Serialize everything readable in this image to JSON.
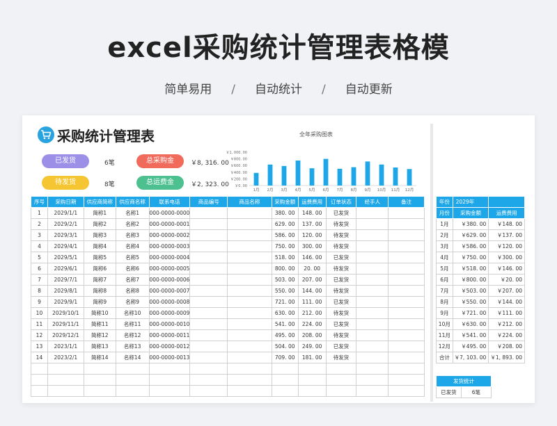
{
  "hero": {
    "title": "excel采购统计管理表格模",
    "tags": [
      "简单易用",
      "/",
      "自动统计",
      "/",
      "自动更新"
    ]
  },
  "sheet": {
    "title": "采购统计管理表",
    "summary": [
      {
        "label": "已发货",
        "value": "6笔",
        "color": "#9b8fe8"
      },
      {
        "label": "待发货",
        "value": "8笔",
        "color": "#f5c631"
      },
      {
        "label": "总采购金",
        "value": "￥8, 316. 00",
        "color": "#f06b5c"
      },
      {
        "label": "总运费金",
        "value": "￥2, 323. 00",
        "color": "#4cc08e"
      }
    ]
  },
  "chart_data": {
    "type": "bar",
    "title": "全年采购图表",
    "categories": [
      "1月",
      "2月",
      "3月",
      "4月",
      "5月",
      "6月",
      "7月",
      "8月",
      "9月",
      "10月",
      "11月",
      "12月"
    ],
    "values": [
      380,
      629,
      586,
      750,
      518,
      800,
      503,
      550,
      721,
      630,
      541,
      495
    ],
    "ylim": [
      0,
      1000
    ],
    "yticks": [
      0,
      200,
      400,
      600,
      800,
      1000
    ],
    "ytick_labels": [
      "￥0. 00",
      "￥200. 00",
      "￥400. 00",
      "￥600. 00",
      "￥800. 00",
      "￥1, 000. 00"
    ],
    "color": "#1ea7e8",
    "grid": false
  },
  "main_table": {
    "headers": [
      "序号",
      "采购日期",
      "供应商简称",
      "供应商名称",
      "联系电话",
      "商品编号",
      "商品名称",
      "采购金额",
      "运费费用",
      "订单状态",
      "经手人",
      "备注"
    ],
    "rows": [
      [
        "1",
        "2029/1/1",
        "简称1",
        "名称1",
        "000-0000-0000",
        "",
        "",
        "380. 00",
        "148. 00",
        "已发货",
        "",
        ""
      ],
      [
        "2",
        "2029/2/1",
        "简称2",
        "名称2",
        "000-0000-0001",
        "",
        "",
        "629. 00",
        "137. 00",
        "待发货",
        "",
        ""
      ],
      [
        "3",
        "2029/3/1",
        "简称3",
        "名称3",
        "000-0000-0002",
        "",
        "",
        "586. 00",
        "120. 00",
        "待发货",
        "",
        ""
      ],
      [
        "4",
        "2029/4/1",
        "简称4",
        "名称4",
        "000-0000-0003",
        "",
        "",
        "750. 00",
        "300. 00",
        "待发货",
        "",
        ""
      ],
      [
        "5",
        "2029/5/1",
        "简称5",
        "名称5",
        "000-0000-0004",
        "",
        "",
        "518. 00",
        "146. 00",
        "已发货",
        "",
        ""
      ],
      [
        "6",
        "2029/6/1",
        "简称6",
        "名称6",
        "000-0000-0005",
        "",
        "",
        "800. 00",
        "20. 00",
        "待发货",
        "",
        ""
      ],
      [
        "7",
        "2029/7/1",
        "简称7",
        "名称7",
        "000-0000-0006",
        "",
        "",
        "503. 00",
        "207. 00",
        "已发货",
        "",
        ""
      ],
      [
        "8",
        "2029/8/1",
        "简称8",
        "名称8",
        "000-0000-0007",
        "",
        "",
        "550. 00",
        "144. 00",
        "待发货",
        "",
        ""
      ],
      [
        "9",
        "2029/9/1",
        "简称9",
        "名称9",
        "000-0000-0008",
        "",
        "",
        "721. 00",
        "111. 00",
        "已发货",
        "",
        ""
      ],
      [
        "10",
        "2029/10/1",
        "简称10",
        "名称10",
        "000-0000-0009",
        "",
        "",
        "630. 00",
        "212. 00",
        "待发货",
        "",
        ""
      ],
      [
        "11",
        "2029/11/1",
        "简称11",
        "名称11",
        "000-0000-0010",
        "",
        "",
        "541. 00",
        "224. 00",
        "已发货",
        "",
        ""
      ],
      [
        "12",
        "2029/12/1",
        "简称12",
        "名称12",
        "000-0000-0011",
        "",
        "",
        "495. 00",
        "208. 00",
        "待发货",
        "",
        ""
      ],
      [
        "13",
        "2023/1/1",
        "简称13",
        "名称13",
        "000-0000-0012",
        "",
        "",
        "504. 00",
        "249. 00",
        "已发货",
        "",
        ""
      ],
      [
        "14",
        "2023/2/1",
        "简称14",
        "名称14",
        "000-0000-0013",
        "",
        "",
        "709. 00",
        "181. 00",
        "待发货",
        "",
        ""
      ],
      [
        "",
        "",
        "",
        "",
        "",
        "",
        "",
        "",
        "",
        "",
        "",
        ""
      ],
      [
        "",
        "",
        "",
        "",
        "",
        "",
        "",
        "",
        "",
        "",
        "",
        ""
      ],
      [
        "",
        "",
        "",
        "",
        "",
        "",
        "",
        "",
        "",
        "",
        "",
        ""
      ]
    ]
  },
  "side_table": {
    "year_label": "年份",
    "year_value": "2029年",
    "headers": [
      "月份",
      "采购金额",
      "运费费用"
    ],
    "rows": [
      [
        "1月",
        "￥380. 00",
        "￥148. 00"
      ],
      [
        "2月",
        "￥629. 00",
        "￥137. 00"
      ],
      [
        "3月",
        "￥586. 00",
        "￥120. 00"
      ],
      [
        "4月",
        "￥750. 00",
        "￥300. 00"
      ],
      [
        "5月",
        "￥518. 00",
        "￥146. 00"
      ],
      [
        "6月",
        "￥800. 00",
        "￥20. 00"
      ],
      [
        "7月",
        "￥503. 00",
        "￥207. 00"
      ],
      [
        "8月",
        "￥550. 00",
        "￥144. 00"
      ],
      [
        "9月",
        "￥721. 00",
        "￥111. 00"
      ],
      [
        "10月",
        "￥630. 00",
        "￥212. 00"
      ],
      [
        "11月",
        "￥541. 00",
        "￥224. 00"
      ],
      [
        "12月",
        "￥495. 00",
        "￥208. 00"
      ],
      [
        "合计",
        "￥7, 103. 00",
        "￥1, 893. 00"
      ]
    ]
  },
  "ship_table": {
    "header": "发货统计",
    "rows": [
      [
        "已发货",
        "6笔"
      ]
    ]
  }
}
